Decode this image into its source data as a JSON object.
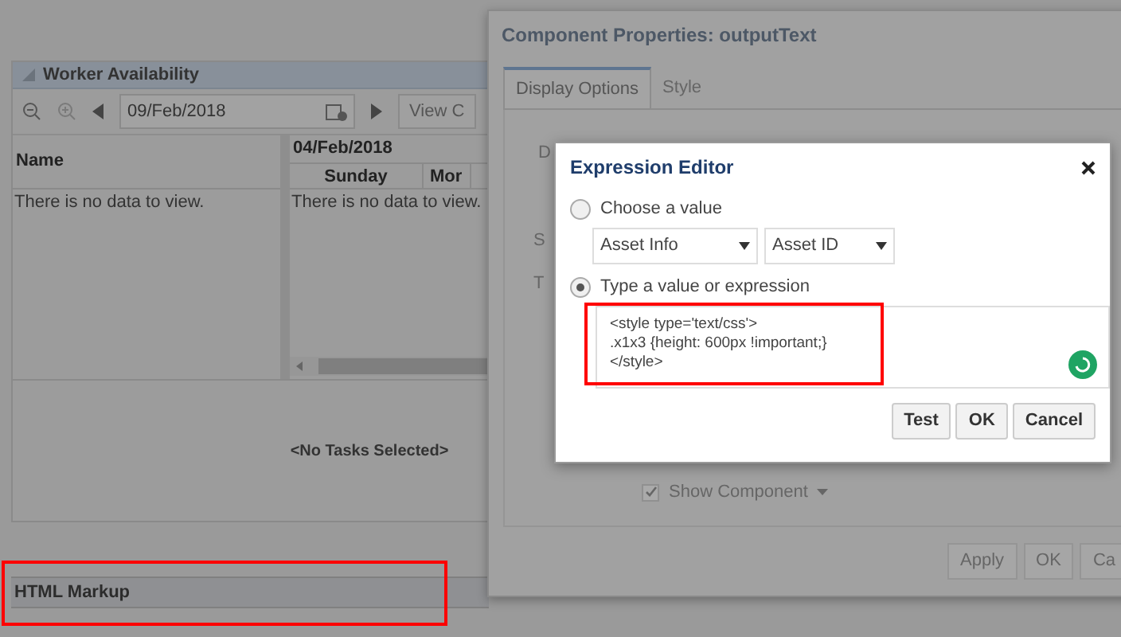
{
  "worker_panel": {
    "title": "Worker Availability",
    "date": "09/Feb/2018",
    "view_button": "View C",
    "name_column": "Name",
    "week": "04/Feb/2018",
    "days": [
      "Sunday",
      "Mor"
    ],
    "empty_left": "There is no data to view.",
    "empty_right": "There is no data to view.",
    "tasks_empty": "<No Tasks Selected>"
  },
  "html_markup": {
    "title": "HTML Markup"
  },
  "properties_dialog": {
    "title": "Component Properties: outputText",
    "tabs": [
      {
        "label": "Display Options",
        "selected": true
      },
      {
        "label": "Style",
        "selected": false
      }
    ],
    "labels": [
      "D",
      "S",
      "T"
    ],
    "show_component": {
      "label": "Show Component",
      "checked": true
    },
    "buttons": [
      "Apply",
      "OK",
      "Ca"
    ]
  },
  "expression_editor": {
    "title": "Expression Editor",
    "options": [
      {
        "label": "Choose a value",
        "selected": false
      },
      {
        "label": "Type a value or expression",
        "selected": true
      }
    ],
    "selects": [
      "Asset Info",
      "Asset ID"
    ],
    "expression": "<style type='text/css'>\n.x1x3 {height: 600px !important;}\n</style>",
    "buttons": [
      "Test",
      "OK",
      "Cancel"
    ]
  }
}
